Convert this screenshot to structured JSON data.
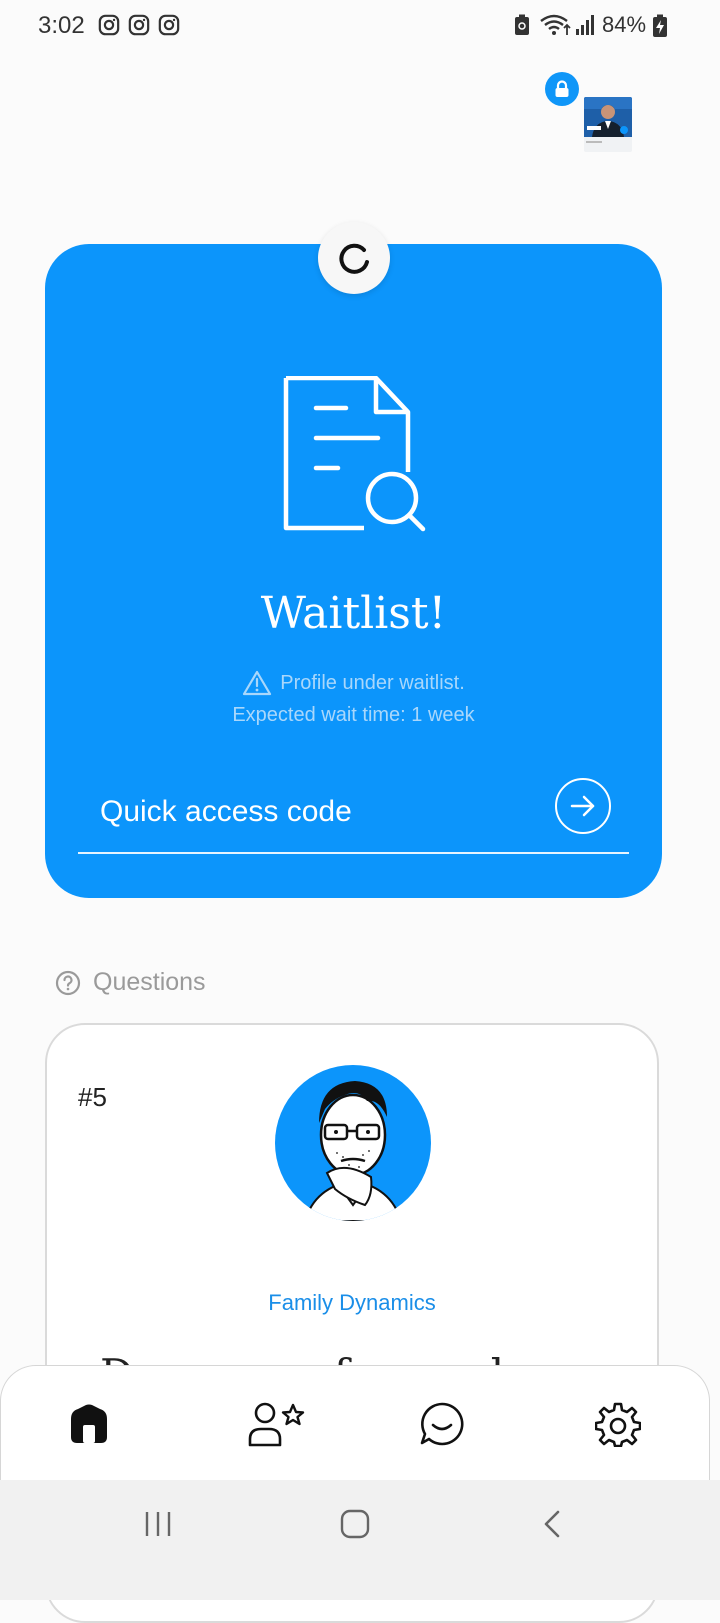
{
  "status_bar": {
    "time": "3:02",
    "notification_icons": [
      "instagram-icon",
      "instagram-icon",
      "instagram-icon"
    ],
    "battery_percent": "84%"
  },
  "profile": {
    "lock_icon": "lock-icon"
  },
  "waitlist_card": {
    "title": "Waitlist!",
    "status": "Profile under waitlist.",
    "eta": "Expected wait time: 1 week",
    "access_code_placeholder": "Quick access code",
    "access_code_value": "",
    "submit_icon": "arrow-right-icon",
    "accent_color": "#0c95fb"
  },
  "questions": {
    "header": "Questions",
    "card": {
      "number": "#5",
      "category": "Family Dynamics",
      "text_partial": "Do you prefer a rela"
    }
  },
  "bottom_nav": {
    "items": [
      {
        "icon": "home-icon",
        "active": true
      },
      {
        "icon": "user-star-icon",
        "active": false
      },
      {
        "icon": "chat-icon",
        "active": false
      },
      {
        "icon": "settings-gear-icon",
        "active": false
      }
    ]
  },
  "system_nav": [
    "recents-icon",
    "home-icon",
    "back-icon"
  ]
}
